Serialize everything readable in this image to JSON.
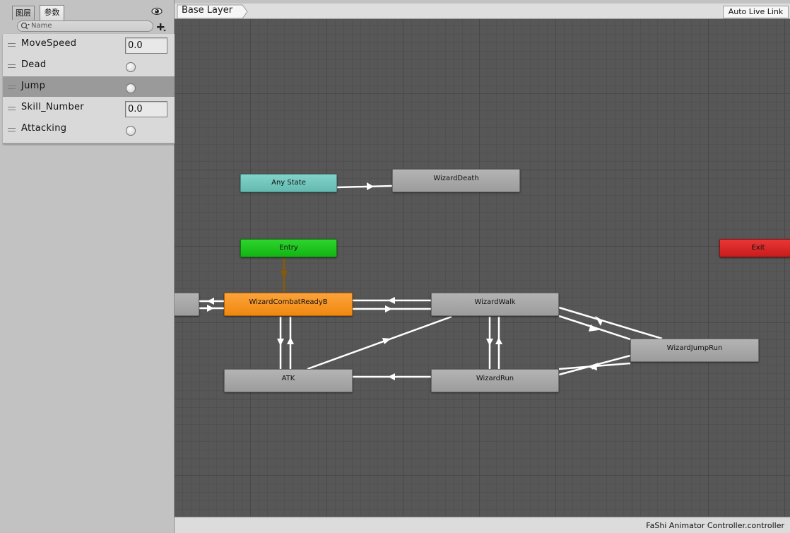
{
  "left_panel": {
    "tabs": [
      {
        "label": "图层"
      },
      {
        "label": "参数"
      }
    ],
    "search": {
      "placeholder": "Name"
    },
    "parameters": [
      {
        "name": "MoveSpeed",
        "type": "float",
        "value": "0.0",
        "selected": false
      },
      {
        "name": "Dead",
        "type": "bool",
        "selected": false
      },
      {
        "name": "Jump",
        "type": "trigger",
        "selected": true
      },
      {
        "name": "Skill_Number",
        "type": "float",
        "value": "0.0",
        "selected": false
      },
      {
        "name": "Attacking",
        "type": "bool",
        "selected": false
      }
    ]
  },
  "graph_header": {
    "breadcrumb": "Base Layer",
    "auto_live_link_label": "Auto Live Link"
  },
  "graph": {
    "states": {
      "any_state": "Any State",
      "wizard_death": "WizardDeath",
      "entry": "Entry",
      "exit": "Exit",
      "wizard_combat_ready": "WizardCombatReadyB",
      "wizard_walk": "WizardWalk",
      "wizard_jump_run": "WizardJumpRun",
      "atk": "ATK",
      "wizard_run": "WizardRun"
    },
    "colors": {
      "any_state": "#72c6bd",
      "entry": "#1ec61e",
      "exit": "#dc2828",
      "default_state": "#f5962a",
      "state": "#a8a8a8",
      "entry_transition": "#8a5a00",
      "transition": "#ffffff"
    }
  },
  "status_bar": {
    "file_name": "FaShi Animator Controller.controller"
  }
}
